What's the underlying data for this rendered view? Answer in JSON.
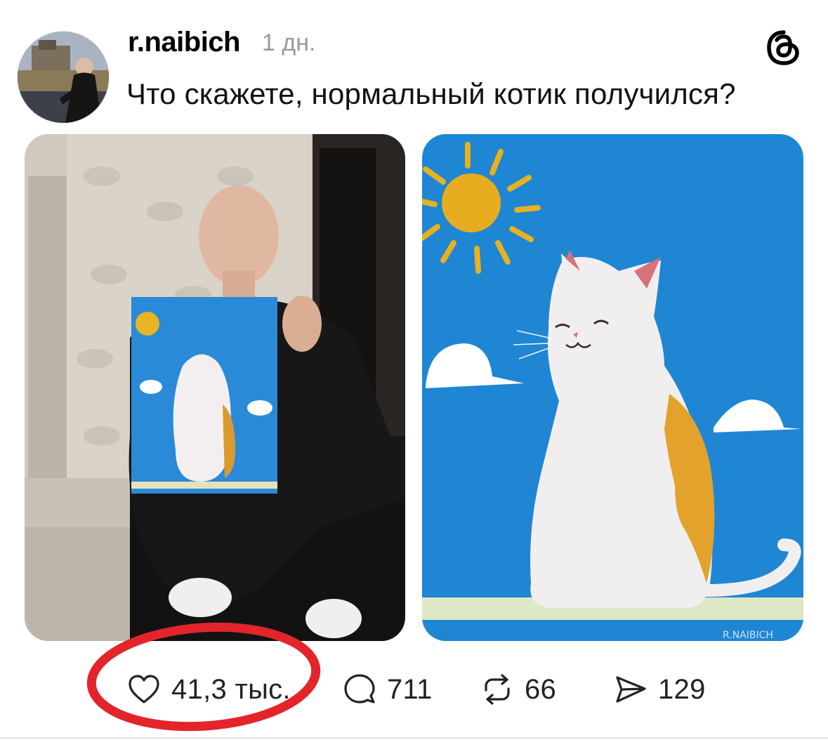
{
  "post": {
    "username": "r.naibich",
    "time": "1 дн.",
    "caption": "Что скажете, нормальный котик получился?"
  },
  "painting_signature": "R.NAIBICH",
  "actions": {
    "likes": "41,3 тыс.",
    "replies": "711",
    "reposts": "66",
    "shares": "129"
  },
  "icons": {
    "app": "threads-logo-icon",
    "like": "heart-icon",
    "reply": "comment-icon",
    "repost": "repost-icon",
    "share": "send-icon"
  },
  "colors": {
    "highlight_ring": "#e3242b",
    "sky": "#1e8ad6",
    "sun": "#e9b11f"
  }
}
